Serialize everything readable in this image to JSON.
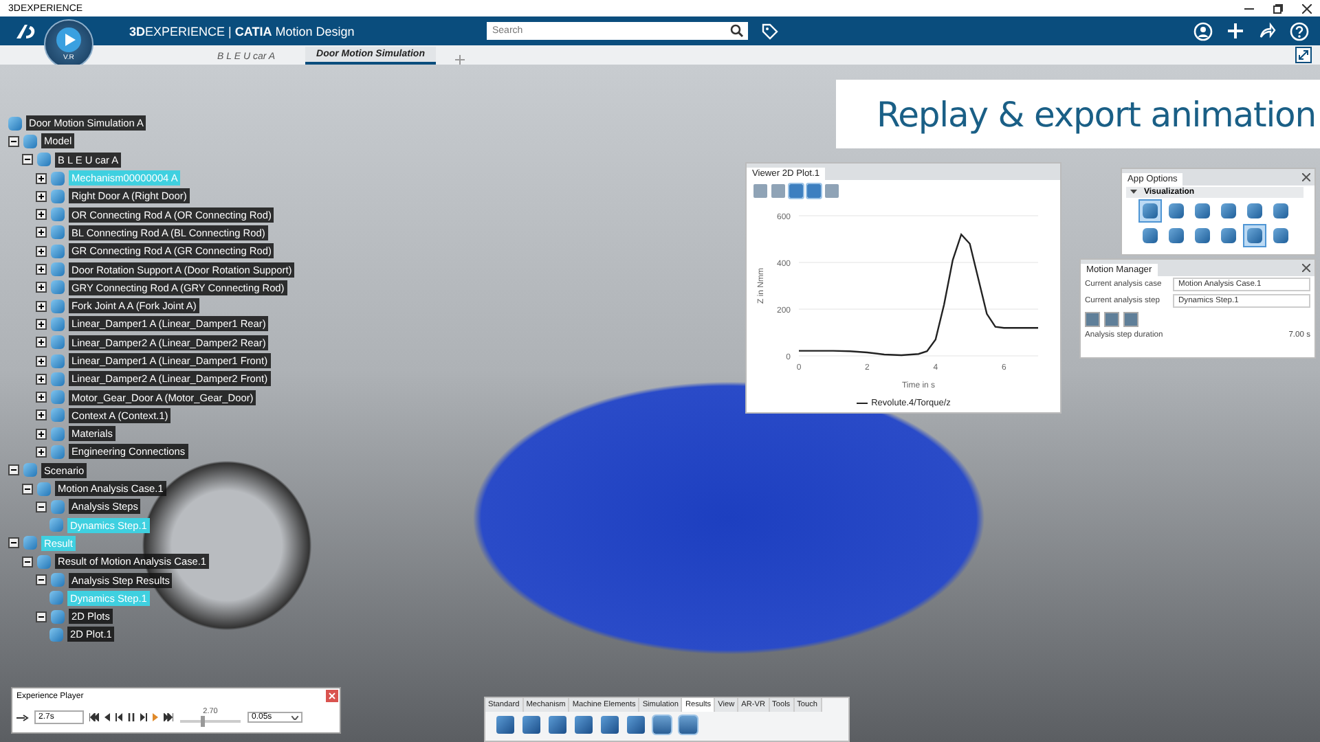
{
  "os_window": {
    "title": "3DEXPERIENCE"
  },
  "app_bar": {
    "brand": "**3D**EXPERIENCE | **CATIA** Motion Design",
    "compass_label": "V.R",
    "search": {
      "placeholder": "Search"
    }
  },
  "tabs": [
    {
      "label": "B L E U car A",
      "selected": false
    },
    {
      "label": "Door Motion Simulation",
      "selected": true
    }
  ],
  "banner": "Replay & export animation",
  "tree": [
    {
      "label": "Door Motion Simulation A",
      "selected": false,
      "children": [
        {
          "label": "Model",
          "selected": false,
          "expanded": true,
          "children": [
            {
              "label": "B L E U car A",
              "selected": false,
              "expanded": true,
              "children": [
                {
                  "label": "Mechanism00000004 A",
                  "selected": true,
                  "expanded": false
                },
                {
                  "label": "Right Door A (Right Door)",
                  "selected": false,
                  "expanded": false
                },
                {
                  "label": "OR Connecting Rod A (OR Connecting Rod)",
                  "selected": false,
                  "expanded": false
                },
                {
                  "label": "BL Connecting Rod A (BL Connecting Rod)",
                  "selected": false,
                  "expanded": false
                },
                {
                  "label": "GR Connecting Rod A (GR Connecting Rod)",
                  "selected": false,
                  "expanded": false
                },
                {
                  "label": "Door Rotation Support A (Door Rotation Support)",
                  "selected": false,
                  "expanded": false
                },
                {
                  "label": "GRY Connecting Rod A (GRY Connecting Rod)",
                  "selected": false,
                  "expanded": false
                },
                {
                  "label": "Fork Joint A A (Fork Joint A)",
                  "selected": false,
                  "expanded": false
                },
                {
                  "label": "Linear_Damper1 A (Linear_Damper1 Rear)",
                  "selected": false,
                  "expanded": false
                },
                {
                  "label": "Linear_Damper2 A (Linear_Damper2 Rear)",
                  "selected": false,
                  "expanded": false
                },
                {
                  "label": "Linear_Damper1 A (Linear_Damper1 Front)",
                  "selected": false,
                  "expanded": false
                },
                {
                  "label": "Linear_Damper2 A (Linear_Damper2 Front)",
                  "selected": false,
                  "expanded": false
                },
                {
                  "label": "Motor_Gear_Door A (Motor_Gear_Door)",
                  "selected": false,
                  "expanded": false
                },
                {
                  "label": "Context A (Context.1)",
                  "selected": false,
                  "expanded": false
                },
                {
                  "label": "Materials",
                  "selected": false,
                  "expanded": false
                },
                {
                  "label": "Engineering Connections",
                  "selected": false,
                  "expanded": false
                }
              ]
            }
          ]
        },
        {
          "label": "Scenario",
          "selected": false,
          "expanded": true,
          "children": [
            {
              "label": "Motion Analysis Case.1",
              "selected": false,
              "expanded": true,
              "children": [
                {
                  "label": "Analysis Steps",
                  "selected": false,
                  "expanded": true,
                  "children": [
                    {
                      "label": "Dynamics Step.1",
                      "selected": true
                    }
                  ]
                }
              ]
            }
          ]
        },
        {
          "label": "Result",
          "selected": true,
          "expanded": true,
          "children": [
            {
              "label": "Result of Motion Analysis Case.1",
              "selected": false,
              "expanded": true,
              "children": [
                {
                  "label": "Analysis Step Results",
                  "selected": false,
                  "expanded": true,
                  "children": [
                    {
                      "label": "Dynamics Step.1",
                      "selected": true
                    }
                  ]
                },
                {
                  "label": "2D Plots",
                  "selected": false,
                  "expanded": true,
                  "children": [
                    {
                      "label": "2D Plot.1",
                      "selected": false
                    }
                  ]
                }
              ]
            }
          ]
        }
      ]
    }
  ],
  "plot_window": {
    "title": "Viewer 2D Plot.1",
    "tools": [
      {
        "active": false
      },
      {
        "active": false
      },
      {
        "active": true
      },
      {
        "active": true
      },
      {
        "active": false
      }
    ],
    "chart_data": {
      "type": "line",
      "xlabel": "Time in s",
      "ylabel": "Z in Nmm",
      "x": [
        0,
        0.5,
        1,
        1.5,
        2,
        2.5,
        3,
        3.5,
        3.75,
        4,
        4.25,
        4.5,
        4.75,
        5,
        5.25,
        5.5,
        5.75,
        6,
        6.5,
        7
      ],
      "series": [
        {
          "name": "Revolute.4/Torque/z",
          "color": "#222222",
          "values": [
            22,
            22,
            22,
            20,
            15,
            6,
            3,
            8,
            20,
            70,
            220,
            410,
            520,
            480,
            330,
            180,
            125,
            120,
            120,
            120
          ]
        }
      ],
      "xlim": [
        0,
        7
      ],
      "ylim": [
        0,
        600
      ],
      "xticks": [
        0,
        2,
        4,
        6
      ],
      "yticks": [
        0,
        200,
        400,
        600
      ]
    }
  },
  "app_options": {
    "title": "App Options",
    "section": {
      "label": "Visualization",
      "expanded": true
    },
    "tools": [
      {
        "active": true
      },
      {
        "active": false
      },
      {
        "active": false
      },
      {
        "active": false
      },
      {
        "active": false
      },
      {
        "active": false
      },
      {
        "active": false
      },
      {
        "active": false
      },
      {
        "active": false
      },
      {
        "active": false
      },
      {
        "active": true
      },
      {
        "active": false
      }
    ]
  },
  "motion_manager": {
    "title": "Motion Manager",
    "fields": [
      {
        "label": "Current analysis case",
        "value": "Motion Analysis Case.1"
      },
      {
        "label": "Current analysis step",
        "value": "Dynamics Step.1"
      }
    ],
    "duration_label": "Analysis step duration",
    "duration": "7.00 s"
  },
  "player": {
    "title": "Experience Player",
    "time": "2.7s",
    "level": 0.386,
    "reading": "2.70",
    "step": "0.05s"
  },
  "toolbar": {
    "tabs": [
      {
        "label": "Standard",
        "selected": false
      },
      {
        "label": "Mechanism",
        "selected": false
      },
      {
        "label": "Machine Elements",
        "selected": false
      },
      {
        "label": "Simulation",
        "selected": false
      },
      {
        "label": "Results",
        "selected": true
      },
      {
        "label": "View",
        "selected": false
      },
      {
        "label": "AR-VR",
        "selected": false
      },
      {
        "label": "Tools",
        "selected": false
      },
      {
        "label": "Touch",
        "selected": false
      }
    ]
  }
}
